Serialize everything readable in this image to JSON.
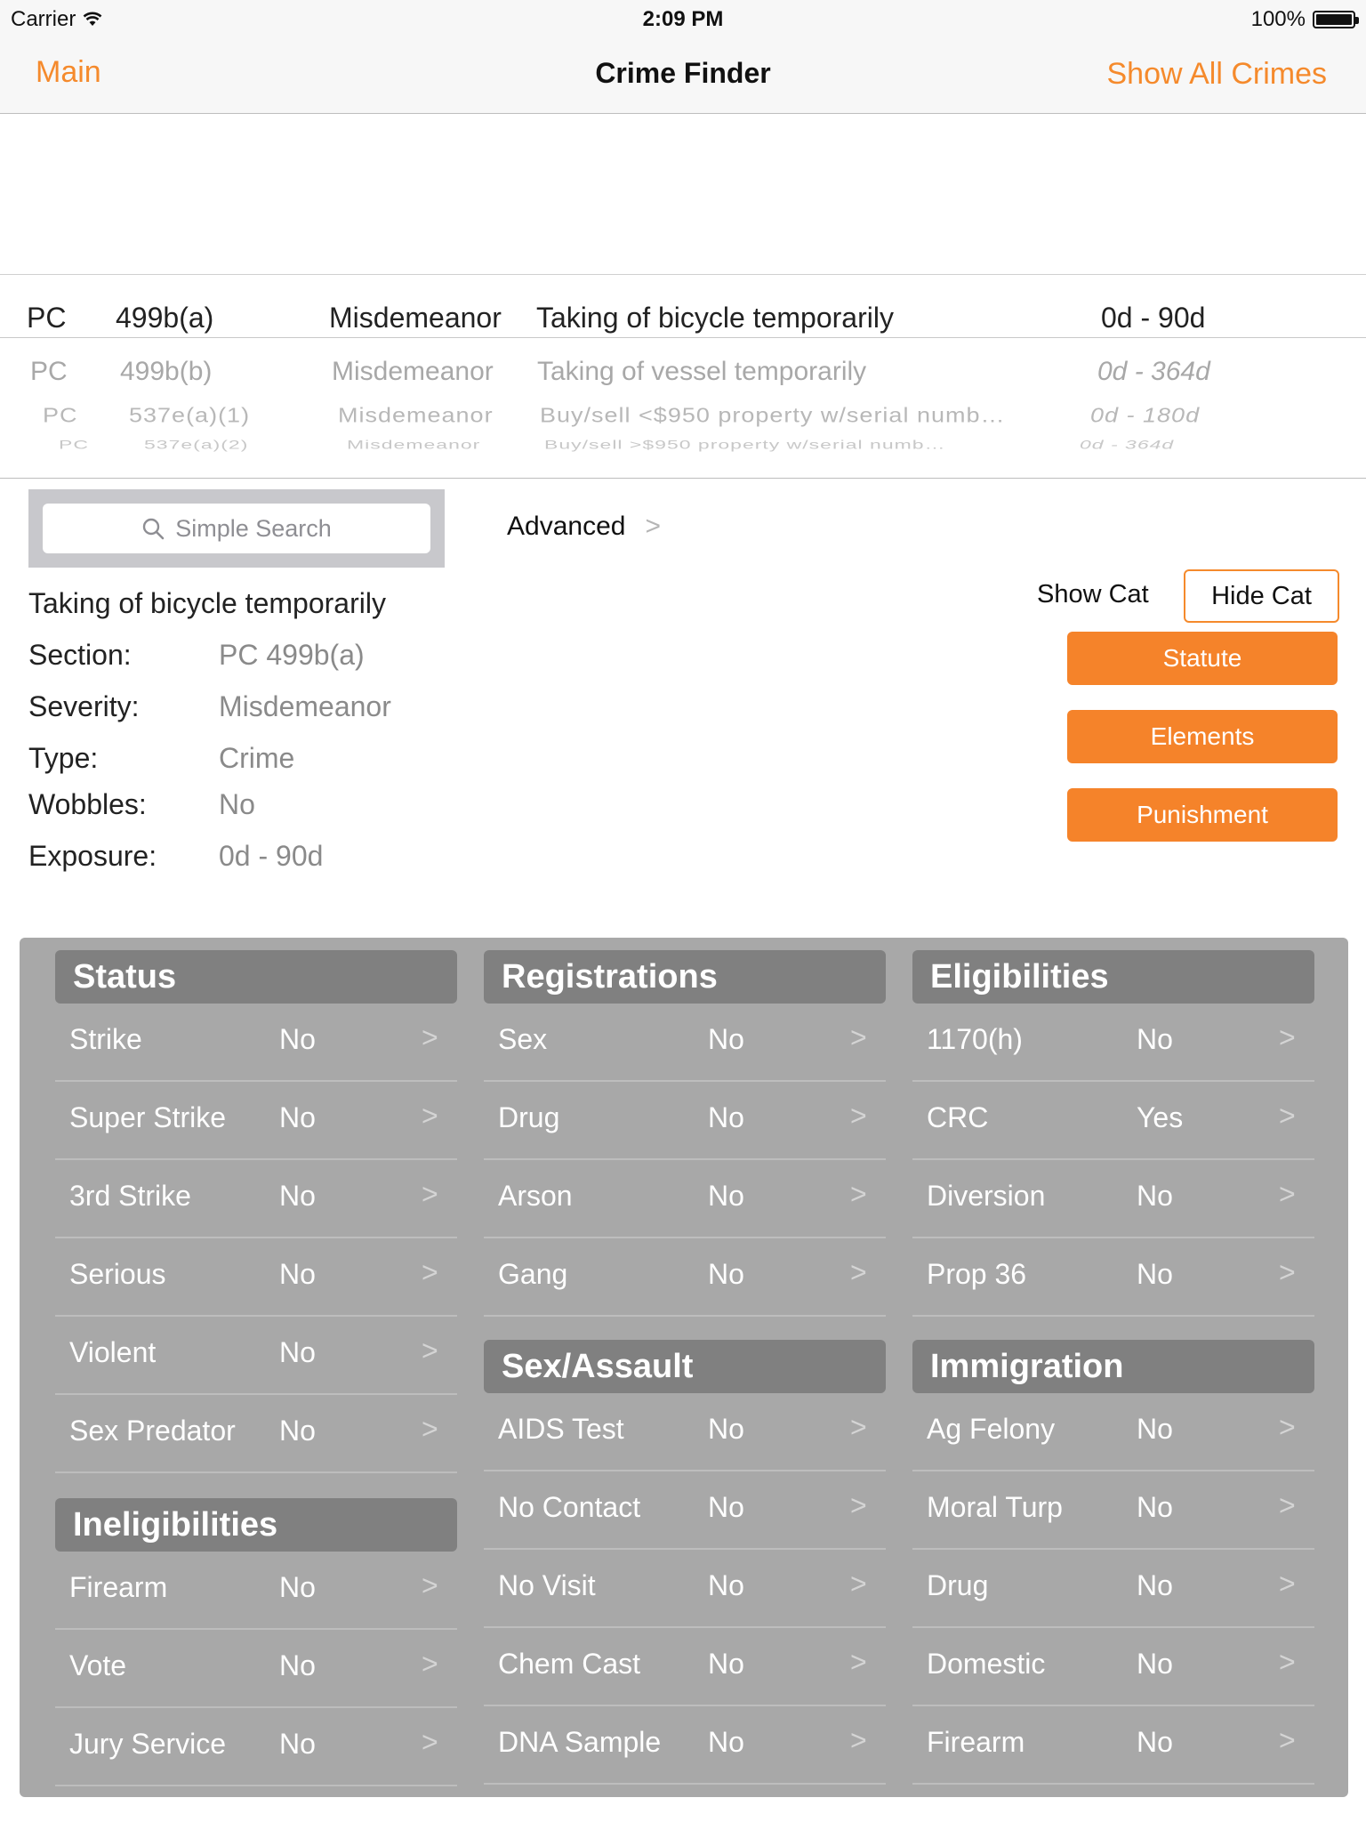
{
  "status_bar": {
    "carrier": "Carrier",
    "time": "2:09 PM",
    "battery": "100%"
  },
  "nav": {
    "back_label": "Main",
    "title": "Crime Finder",
    "action_label": "Show All Crimes"
  },
  "picker": {
    "rows": [
      {
        "code": "PC",
        "section": "499b(a)",
        "severity": "Misdemeanor",
        "description": "Taking of bicycle temporarily",
        "exposure": "0d - 90d"
      },
      {
        "code": "PC",
        "section": "499b(b)",
        "severity": "Misdemeanor",
        "description": "Taking of vessel temporarily",
        "exposure": "0d - 364d"
      },
      {
        "code": "PC",
        "section": "537e(a)(1)",
        "severity": "Misdemeanor",
        "description": "Buy/sell <$950 property w/serial numb…",
        "exposure": "0d - 180d"
      },
      {
        "code": "PC",
        "section": "537e(a)(2)",
        "severity": "Misdemeanor",
        "description": "Buy/sell >$950 property w/serial numb…",
        "exposure": "0d - 364d"
      }
    ]
  },
  "search": {
    "placeholder": "Simple Search",
    "advanced_label": "Advanced",
    "chevron": ">"
  },
  "crime": {
    "title": "Taking of bicycle temporarily",
    "details": [
      {
        "label": "Section:",
        "value": "PC 499b(a)"
      },
      {
        "label": "Severity:",
        "value": "Misdemeanor"
      },
      {
        "label": "Type:",
        "value": "Crime"
      },
      {
        "label": "Wobbles:",
        "value": "No"
      },
      {
        "label": "Exposure:",
        "value": "0d - 90d"
      }
    ]
  },
  "category_toggle": {
    "show_label": "Show Cat",
    "hide_label": "Hide Cat"
  },
  "actions": {
    "statute": "Statute",
    "elements": "Elements",
    "punishment": "Punishment"
  },
  "panel": {
    "status": {
      "title": "Status",
      "items": [
        {
          "name": "Strike",
          "value": "No"
        },
        {
          "name": "Super Strike",
          "value": "No"
        },
        {
          "name": "3rd Strike",
          "value": "No"
        },
        {
          "name": "Serious",
          "value": "No"
        },
        {
          "name": "Violent",
          "value": "No"
        },
        {
          "name": "Sex Predator",
          "value": "No"
        }
      ]
    },
    "ineligibilities": {
      "title": "Ineligibilities",
      "items": [
        {
          "name": "Firearm",
          "value": "No"
        },
        {
          "name": "Vote",
          "value": "No"
        },
        {
          "name": "Jury Service",
          "value": "No"
        }
      ]
    },
    "registrations": {
      "title": "Registrations",
      "items": [
        {
          "name": "Sex",
          "value": "No"
        },
        {
          "name": "Drug",
          "value": "No"
        },
        {
          "name": "Arson",
          "value": "No"
        },
        {
          "name": "Gang",
          "value": "No"
        }
      ]
    },
    "sex_assault": {
      "title": "Sex/Assault",
      "items": [
        {
          "name": "AIDS Test",
          "value": "No"
        },
        {
          "name": "No Contact",
          "value": "No"
        },
        {
          "name": "No Visit",
          "value": "No"
        },
        {
          "name": "Chem Cast",
          "value": "No"
        },
        {
          "name": "DNA Sample",
          "value": "No"
        }
      ]
    },
    "eligibilities": {
      "title": "Eligibilities",
      "items": [
        {
          "name": "1170(h)",
          "value": "No"
        },
        {
          "name": "CRC",
          "value": "Yes"
        },
        {
          "name": "Diversion",
          "value": "No"
        },
        {
          "name": "Prop 36",
          "value": "No"
        }
      ]
    },
    "immigration": {
      "title": "Immigration",
      "items": [
        {
          "name": "Ag Felony",
          "value": "No"
        },
        {
          "name": "Moral Turp",
          "value": "No"
        },
        {
          "name": "Drug",
          "value": "No"
        },
        {
          "name": "Domestic",
          "value": "No"
        },
        {
          "name": "Firearm",
          "value": "No"
        }
      ]
    }
  },
  "colors": {
    "accent": "#f58a2c",
    "panel_bg": "#a8a8a8",
    "section_header_bg": "#808080"
  }
}
